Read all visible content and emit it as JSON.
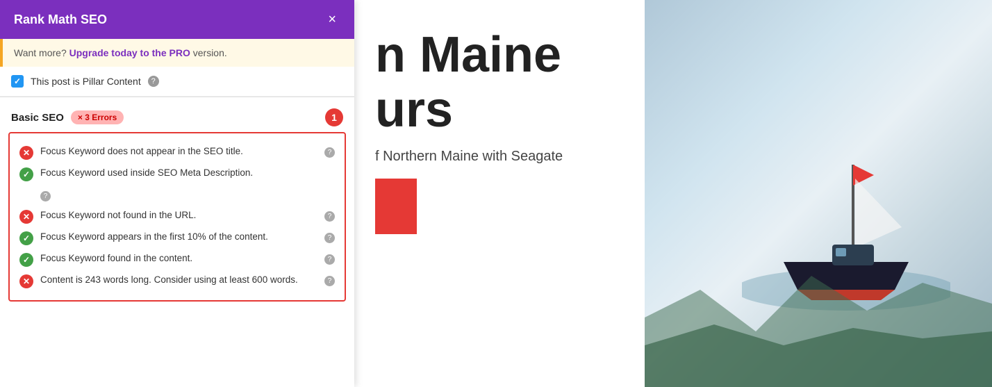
{
  "panel": {
    "header": {
      "title": "Rank Math SEO",
      "close_label": "×"
    },
    "upgrade_notice": {
      "text": "Want more?",
      "link_text": "Upgrade today to the PRO",
      "text_after": "version."
    },
    "pillar_content": {
      "label": "This post is Pillar Content",
      "help_icon": "?"
    },
    "basic_seo": {
      "title": "Basic SEO",
      "errors_badge": "× 3 Errors",
      "notification_number": "1",
      "checklist": [
        {
          "status": "error",
          "text": "Focus Keyword does not appear in the SEO title.",
          "has_help": true
        },
        {
          "status": "success",
          "text": "Focus Keyword used inside SEO Meta Description.",
          "has_help": false
        },
        {
          "status": "error",
          "text": "Focus Keyword not found in the URL.",
          "has_help": true
        },
        {
          "status": "success",
          "text": "Focus Keyword appears in the first 10% of the content.",
          "has_help": true
        },
        {
          "status": "success",
          "text": "Focus Keyword found in the content.",
          "has_help": true
        },
        {
          "status": "error",
          "text": "Content is 243 words long. Consider using at least 600 words.",
          "has_help": true
        }
      ]
    }
  },
  "background": {
    "title_line1": "n Maine",
    "title_line2": "urs",
    "subtitle": "f Northern Maine with Seagate"
  },
  "icons": {
    "check": "✓",
    "cross": "✕",
    "close": "×",
    "question": "?"
  }
}
